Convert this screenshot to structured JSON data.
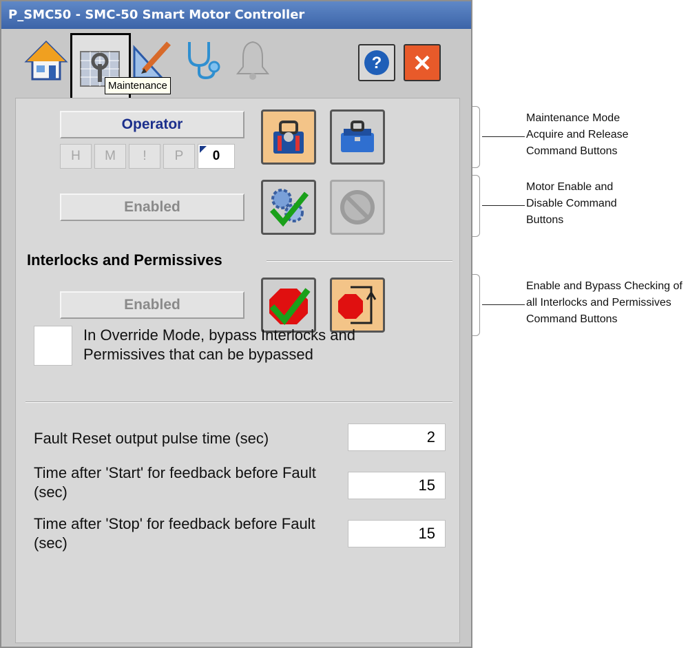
{
  "window": {
    "title": "P_SMC50 - SMC-50 Smart Motor Controller"
  },
  "tabs": [
    {
      "icon": "home-icon"
    },
    {
      "icon": "maintenance-wrench-icon",
      "tooltip": "Maintenance"
    },
    {
      "icon": "engineering-pencil-icon"
    },
    {
      "icon": "diagnostics-stethoscope-icon"
    },
    {
      "icon": "alarm-bell-icon"
    }
  ],
  "window_buttons": {
    "help": "?",
    "close": "×"
  },
  "maintenance": {
    "mode_status": "Operator",
    "indicators": [
      "H",
      "M",
      "!",
      "P"
    ],
    "count": "0",
    "enable_status": "Enabled"
  },
  "interlocks": {
    "title": "Interlocks and Permissives",
    "status": "Enabled",
    "override_label": "In Override Mode, bypass Interlocks and Permissives that can be bypassed"
  },
  "params": [
    {
      "label": "Fault Reset output pulse time (sec)",
      "value": "2"
    },
    {
      "label": "Time after 'Start' for feedback before Fault (sec)",
      "value": "15"
    },
    {
      "label": "Time after 'Stop' for feedback before Fault (sec)",
      "value": "15"
    }
  ],
  "annotations": [
    {
      "lines": [
        "Maintenance Mode",
        "Acquire and Release",
        "Command Buttons"
      ]
    },
    {
      "lines": [
        "Motor Enable and",
        "Disable Command",
        "Buttons"
      ]
    },
    {
      "lines": [
        "Enable and Bypass Checking of",
        "all Interlocks and Permissives",
        "Command Buttons"
      ]
    }
  ],
  "colors": {
    "title_bar": "#4a73b8",
    "accent_orange": "#f3c488",
    "panel": "#d8d8d8"
  }
}
